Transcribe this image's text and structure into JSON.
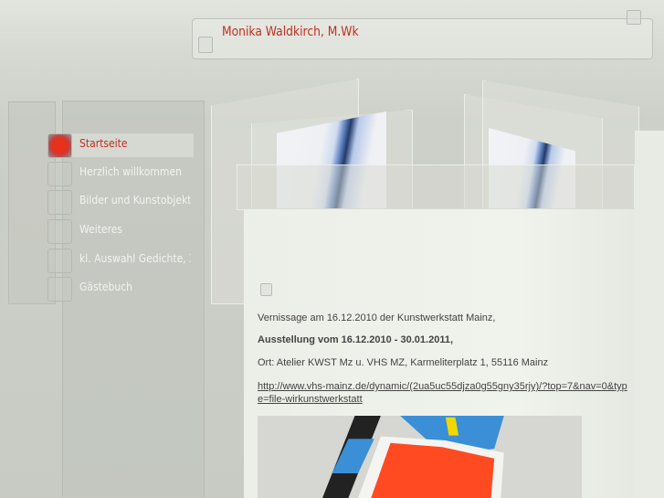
{
  "header": {
    "title": "Monika Waldkirch, M.Wk"
  },
  "nav": {
    "items": [
      {
        "label": "Startseite",
        "active": true
      },
      {
        "label": "Herzlich willkommen"
      },
      {
        "label": "Bilder und Kunstobjekte"
      },
      {
        "label": "Weiteres"
      },
      {
        "label": "kl. Auswahl Gedichte, Zitate"
      },
      {
        "label": "Gästebuch"
      }
    ]
  },
  "content": {
    "line1": "Vernissage am 16.12.2010 der Kunstwerkstatt Mainz,",
    "line2": "Ausstellung vom 16.12.2010 - 30.01.2011,",
    "line3": "Ort: Atelier KWST Mz u. VHS MZ, Karmeliterplatz 1, 55116 Mainz",
    "link": "http://www.vhs-mainz.de/dynamic/(2ua5uc55djza0g55gny35rjy)/?top=7&nav=0&type=file-wirkunstwerkstatt"
  },
  "colors": {
    "accent": "#c0301f",
    "background": "#cdd0c9"
  }
}
